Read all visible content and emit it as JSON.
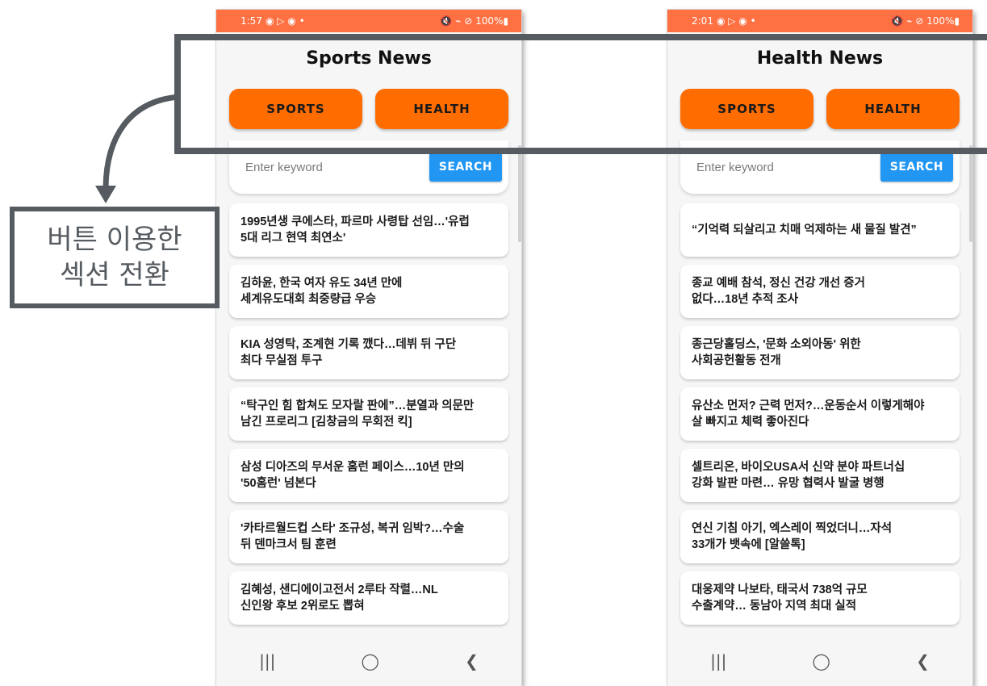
{
  "screens": {
    "left": {
      "status": {
        "time": "1:57",
        "icons": "◉ ▷ ◉ •",
        "right": "🔇 ⌁ ⊘ 100%▮"
      },
      "title": "Sports News",
      "buttons": {
        "sports": "SPORTS",
        "health": "HEALTH"
      },
      "search": {
        "placeholder": "Enter keyword",
        "button": "SEARCH"
      },
      "articles": [
        "1995년생 쿠에스타, 파르마 사령탑 선임…'유럽\n5대 리그 현역 최연소'",
        "김하윤, 한국 여자 유도 34년 만에\n세계유도대회 최중량급 우승",
        "KIA 성영탁, 조계현 기록 깼다…데뷔 뒤 구단\n최다 무실점 투구",
        "“탁구인 힘 합쳐도 모자랄 판에”…분열과 의문만\n남긴 프로리그 [김창금의 무회전 킥]",
        "삼성 디아즈의 무서운 홈런 페이스…10년 만의\n'50홈런' 넘본다",
        "'카타르월드컵 스타' 조규성, 복귀 임박?…수술\n뒤 덴마크서 팀 훈련",
        "김혜성, 샌디에이고전서 2루타 작렬…NL\n신인왕 후보 2위로도 뽑혀"
      ]
    },
    "right": {
      "status": {
        "time": "2:01",
        "icons": "◉ ▷ ◉ •",
        "right": "🔇 ⌁ ⊘ 100%▮"
      },
      "title": "Health News",
      "buttons": {
        "sports": "SPORTS",
        "health": "HEALTH"
      },
      "search": {
        "placeholder": "Enter keyword",
        "button": "SEARCH"
      },
      "articles": [
        "“기억력 되살리고 치매 억제하는 새 물질 발견”",
        "종교 예배 참석, 정신 건강 개선 증거\n없다…18년 추적 조사",
        "종근당홀딩스, '문화 소외아동' 위한\n사회공헌활동 전개",
        "유산소 먼저? 근력 먼저?…운동순서 이렇게해야\n살 빠지고 체력 좋아진다",
        "셀트리온, 바이오USA서 신약 분야 파트너십\n강화 발판 마련… 유망 협력사 발굴 병행",
        "연신 기침 아기, 엑스레이 찍었더니…자석\n33개가 뱃속에 [알쓸톡]",
        "대웅제약 나보타, 태국서 738억 규모\n수출계약… 동남아 지역 최대 실적"
      ]
    }
  },
  "navbar": {
    "recent": "|||",
    "home": "◯",
    "back": "❮"
  },
  "callout": {
    "line1": "버튼 이용한",
    "line2": "섹션 전환"
  },
  "colors": {
    "status_bar": "#ff7043",
    "tab_button": "#ff6d00",
    "search_button": "#2196f3",
    "annotation": "#555b60"
  }
}
